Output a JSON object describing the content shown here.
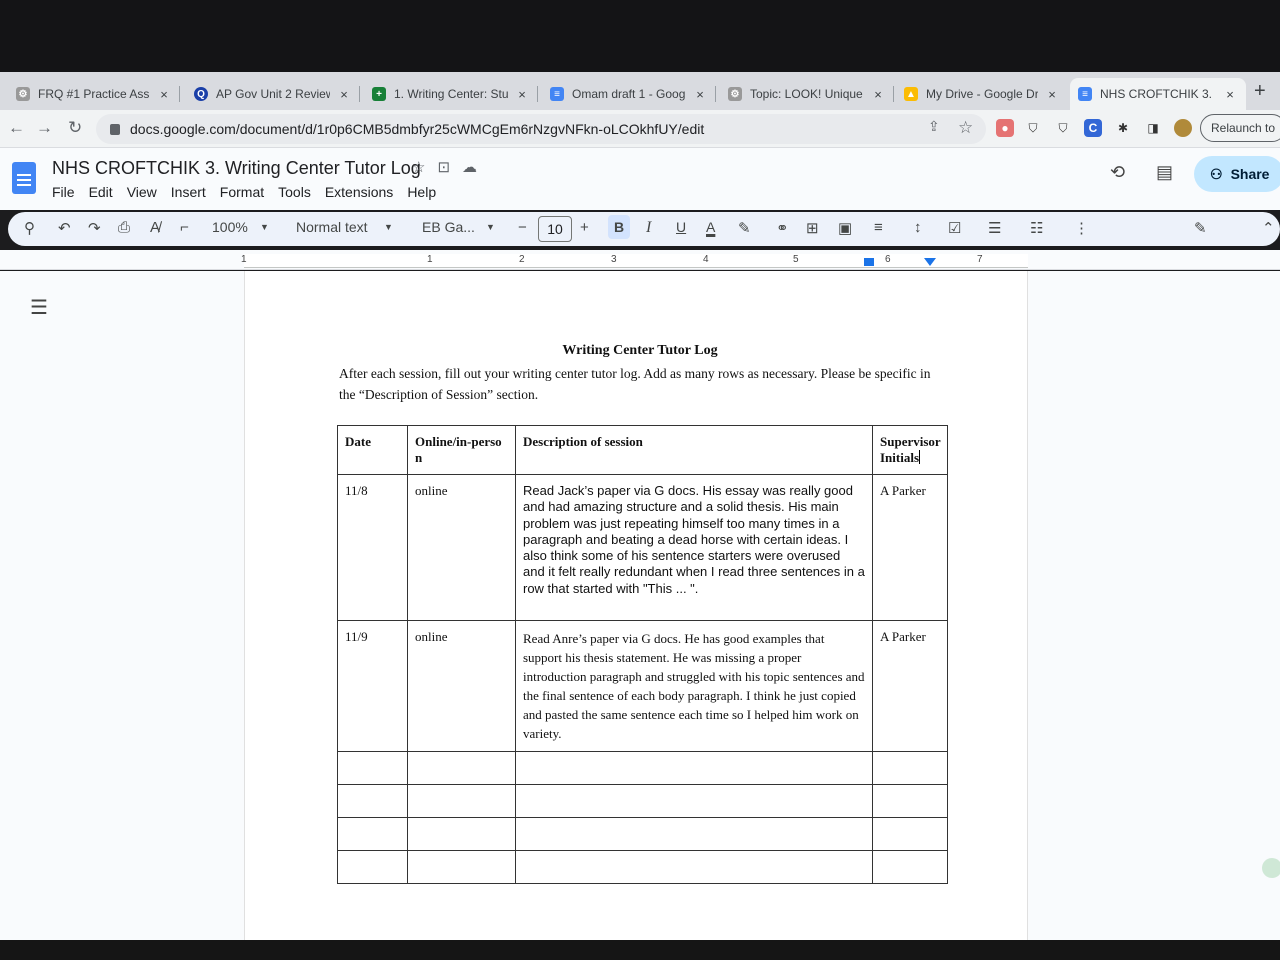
{
  "browser": {
    "tabs": [
      {
        "label": "FRQ #1 Practice Ass",
        "icon": "gear-icon",
        "color": "#888888"
      },
      {
        "label": "AP Gov Unit 2 Review",
        "icon": "quizlet-icon",
        "color": "#1a3fa8"
      },
      {
        "label": "1. Writing Center: Stu",
        "icon": "sheets-icon",
        "color": "#188038"
      },
      {
        "label": "Omam draft 1 - Goog",
        "icon": "docs-icon",
        "color": "#4285f4"
      },
      {
        "label": "Topic: LOOK! Unique",
        "icon": "gear-icon",
        "color": "#888888"
      },
      {
        "label": "My Drive - Google Dr",
        "icon": "drive-icon",
        "color": "#fbbc04"
      },
      {
        "label": "NHS CROFTCHIK 3.",
        "icon": "docs-icon",
        "color": "#4285f4",
        "active": true
      }
    ],
    "tab_close": "×",
    "new_tab": "+",
    "url": "docs.google.com/document/d/1r0p6CMB5dmbfyr25cWMCgEm6rNzgvNFkn-oLCOkhfUY/edit",
    "relaunch_label": "Relaunch to"
  },
  "docs": {
    "title": "NHS CROFTCHIK 3. Writing Center Tutor Log",
    "menu": [
      "File",
      "Edit",
      "View",
      "Insert",
      "Format",
      "Tools",
      "Extensions",
      "Help"
    ],
    "share_label": "Share",
    "toolbar": {
      "zoom": "100%",
      "style": "Normal text",
      "font": "EB Ga...",
      "font_size": "10",
      "bold": "B",
      "italic": "I",
      "underline": "U",
      "text_color": "A"
    },
    "ruler_numbers": [
      "1",
      "1",
      "2",
      "3",
      "4",
      "5",
      "6",
      "7"
    ]
  },
  "document": {
    "heading": "Writing Center Tutor Log",
    "intro": "After each session, fill out your writing center tutor log. Add as many rows as necessary. Please be specific in the “Description of Session” section.",
    "table": {
      "headers": [
        "Date",
        "Online/in-perso n",
        "Description of session",
        "Supervisor Initials"
      ],
      "rows": [
        {
          "date": "11/8",
          "mode": "online",
          "description": "Read Jack’s paper via G docs. His essay was really good and had amazing structure and a solid thesis. His main problem was just repeating himself too many times in a paragraph and beating a dead horse with certain ideas. I also think some of his sentence starters were overused and it felt really redundant when I read three sentences in a row that started with \"This ... \".",
          "initials": "A Parker"
        },
        {
          "date": "11/9",
          "mode": "online",
          "description": "Read Anre’s paper via G docs. He has good examples that support his thesis statement. He was missing a proper introduction paragraph and struggled with his topic sentences and the final sentence of each body paragraph. I think he just copied and pasted the same sentence each time so I helped him work on variety.",
          "initials": "A Parker"
        }
      ],
      "empty_rows": 4
    }
  }
}
